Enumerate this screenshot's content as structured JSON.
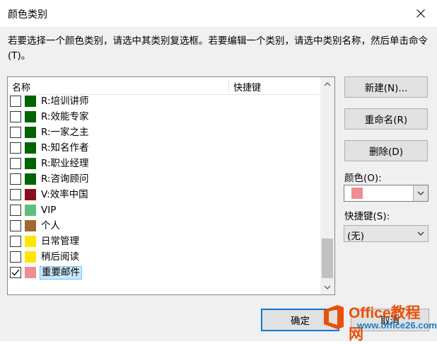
{
  "window": {
    "title": "颜色类别"
  },
  "instruction": "若要选择一个颜色类别，请选中其类别复选框。若要编辑一个类别，请选中类别名称，然后单击命令(T)。",
  "list": {
    "col_name": "名称",
    "col_shortcut": "快捷键",
    "items": [
      {
        "label": "R:培训讲师",
        "color": "#006400",
        "checked": false
      },
      {
        "label": "R:效能专家",
        "color": "#006400",
        "checked": false
      },
      {
        "label": "R:一家之主",
        "color": "#006400",
        "checked": false
      },
      {
        "label": "R:知名作者",
        "color": "#006400",
        "checked": false
      },
      {
        "label": "R:职业经理",
        "color": "#006400",
        "checked": false
      },
      {
        "label": "R:咨询顾问",
        "color": "#006400",
        "checked": false
      },
      {
        "label": "V:效率中国",
        "color": "#8b0f1a",
        "checked": false
      },
      {
        "label": "VIP",
        "color": "#5fbe7d",
        "checked": false
      },
      {
        "label": "个人",
        "color": "#a2692d",
        "checked": false
      },
      {
        "label": "日常管理",
        "color": "#ffe500",
        "checked": false
      },
      {
        "label": "稍后阅读",
        "color": "#ffe500",
        "checked": false
      },
      {
        "label": "重要邮件",
        "color": "#f08d93",
        "checked": true,
        "selected": true
      }
    ]
  },
  "buttons": {
    "new": "新建(N)...",
    "rename": "重命名(R)",
    "delete": "删除(D)",
    "ok": "确定",
    "cancel": "取消"
  },
  "color_field": {
    "label": "颜色(O):",
    "value_color": "#f08d93"
  },
  "shortcut_field": {
    "label": "快捷键(S):",
    "value": "(无)"
  },
  "watermark": {
    "brand": "Office教程网",
    "url": "www.office26.com"
  },
  "colors": {
    "accent": "#0078d7",
    "selection": "#cce8ff"
  }
}
